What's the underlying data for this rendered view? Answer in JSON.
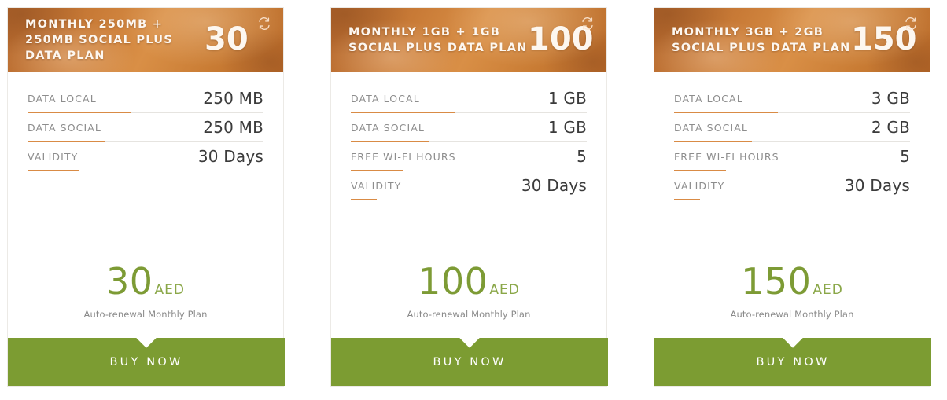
{
  "colors": {
    "header_orange": "#c87a36",
    "accent_orange": "#d98b45",
    "green": "#7c9c32",
    "price_green": "#7d9b35",
    "label_gray": "#8d8d8d",
    "value_dark": "#3b3b3b"
  },
  "icons": {
    "renew": "auto-renewal-icon"
  },
  "cards": [
    {
      "title": "MONTHLY 250MB + 250MB SOCIAL PLUS DATA PLAN",
      "header_amount": "30",
      "specs": [
        {
          "label": "DATA LOCAL",
          "value": "250 MB",
          "accent_width": "44%"
        },
        {
          "label": "DATA SOCIAL",
          "value": "250 MB",
          "accent_width": "33%"
        },
        {
          "label": "VALIDITY",
          "value": "30 Days",
          "accent_width": "22%"
        }
      ],
      "price": {
        "amount": "30",
        "currency": "AED",
        "note": "Auto-renewal Monthly Plan"
      },
      "buy_label": "BUY NOW"
    },
    {
      "title": "MONTHLY 1GB + 1GB SOCIAL PLUS DATA PLAN",
      "header_amount": "100",
      "specs": [
        {
          "label": "DATA LOCAL",
          "value": "1 GB",
          "accent_width": "44%"
        },
        {
          "label": "DATA SOCIAL",
          "value": "1 GB",
          "accent_width": "33%"
        },
        {
          "label": "FREE WI-FI HOURS",
          "value": "5",
          "accent_width": "22%"
        },
        {
          "label": "VALIDITY",
          "value": "30 Days",
          "accent_width": "11%"
        }
      ],
      "price": {
        "amount": "100",
        "currency": "AED",
        "note": "Auto-renewal Monthly Plan"
      },
      "buy_label": "BUY NOW"
    },
    {
      "title": "MONTHLY 3GB + 2GB SOCIAL PLUS DATA PLAN",
      "header_amount": "150",
      "specs": [
        {
          "label": "DATA LOCAL",
          "value": "3 GB",
          "accent_width": "44%"
        },
        {
          "label": "DATA SOCIAL",
          "value": "2 GB",
          "accent_width": "33%"
        },
        {
          "label": "FREE WI-FI HOURS",
          "value": "5",
          "accent_width": "22%"
        },
        {
          "label": "VALIDITY",
          "value": "30 Days",
          "accent_width": "11%"
        }
      ],
      "price": {
        "amount": "150",
        "currency": "AED",
        "note": "Auto-renewal Monthly Plan"
      },
      "buy_label": "BUY NOW"
    }
  ]
}
